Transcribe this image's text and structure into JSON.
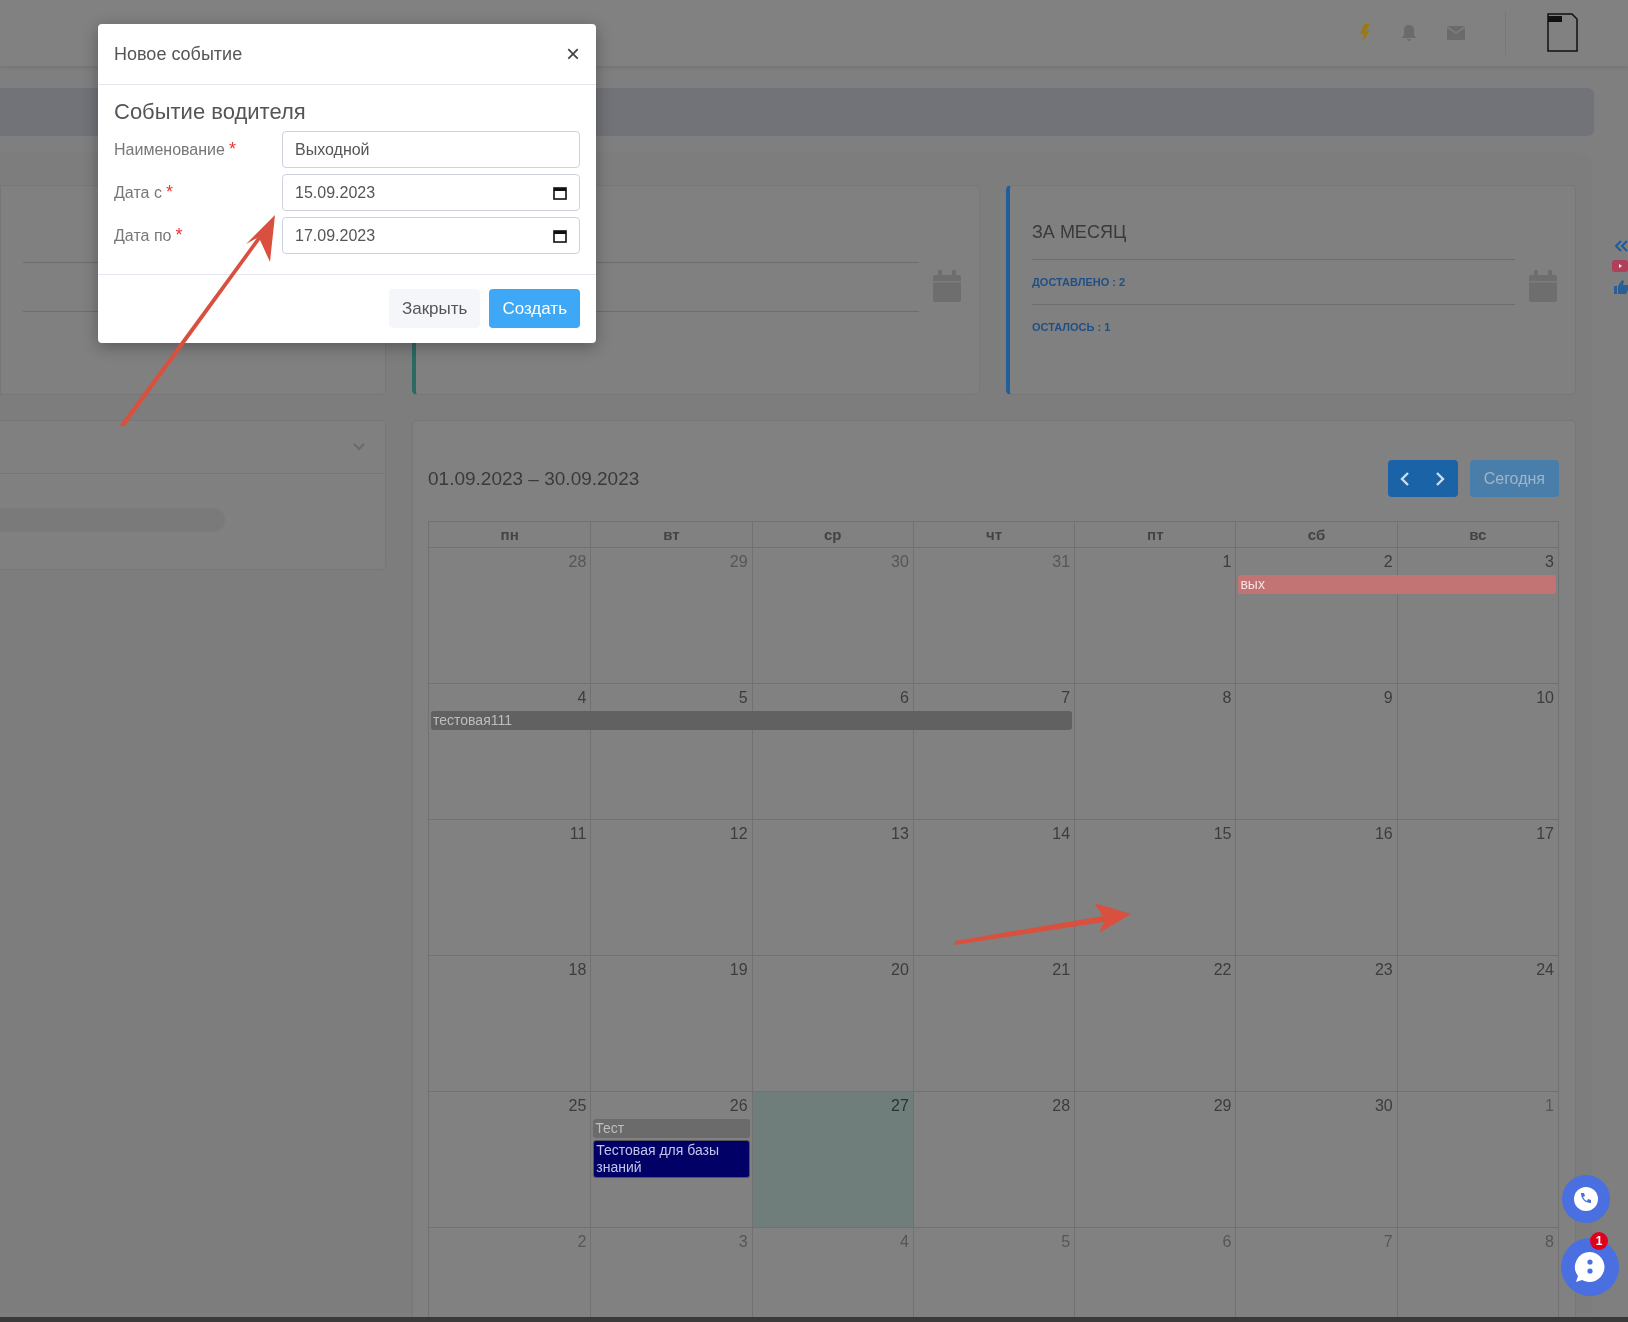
{
  "modal": {
    "title": "Новое событие",
    "close": "×",
    "heading": "Событие водителя",
    "fields": [
      {
        "kind": "text",
        "label": "Наименование",
        "required_mark": "*",
        "value": "Выходной"
      },
      {
        "kind": "date",
        "label": "Дата с",
        "required_mark": "*",
        "value": "15.09.2023"
      },
      {
        "kind": "date",
        "label": "Дата по",
        "required_mark": "*",
        "value": "17.09.2023"
      }
    ],
    "buttons": [
      {
        "kind": "secondary",
        "label": "Закрыть"
      },
      {
        "kind": "primary",
        "label": "Создать"
      }
    ]
  },
  "month_card": {
    "title": "ЗА МЕСЯЦ",
    "stats": [
      "ДОСТАВЛЕНО : 2",
      "ОСТАЛОСЬ : 1"
    ]
  },
  "calendar": {
    "range": "01.09.2023 – 30.09.2023",
    "today_button": "Сегодня",
    "weekdays": [
      "пн",
      "вт",
      "ср",
      "чт",
      "пт",
      "сб",
      "вс"
    ],
    "weeks": [
      {
        "days": [
          {
            "day": "28",
            "other_month": true,
            "today": false
          },
          {
            "day": "29",
            "other_month": true,
            "today": false
          },
          {
            "day": "30",
            "other_month": true,
            "today": false
          },
          {
            "day": "31",
            "other_month": true,
            "today": false
          },
          {
            "day": "1",
            "other_month": false,
            "today": false
          },
          {
            "day": "2",
            "other_month": false,
            "today": false,
            "events": [
              {
                "kind": "start",
                "title": "вых",
                "color": "#c27373"
              }
            ]
          },
          {
            "day": "3",
            "other_month": false,
            "today": false,
            "events": [
              {
                "kind": "continued",
                "color": "#c27373"
              }
            ]
          }
        ]
      },
      {
        "days": [
          {
            "day": "4",
            "other_month": false,
            "today": false,
            "events": [
              {
                "kind": "start",
                "title": "тестовая111",
                "color": "#616161"
              }
            ]
          },
          {
            "day": "5",
            "other_month": false,
            "today": false,
            "events": [
              {
                "kind": "continued",
                "color": "#616161"
              }
            ]
          },
          {
            "day": "6",
            "other_month": false,
            "today": false,
            "events": [
              {
                "kind": "continued",
                "color": "#616161"
              }
            ]
          },
          {
            "day": "7",
            "other_month": false,
            "today": false,
            "events": [
              {
                "kind": "continued",
                "color": "#616161"
              }
            ]
          },
          {
            "day": "8",
            "other_month": false,
            "today": false
          },
          {
            "day": "9",
            "other_month": false,
            "today": false
          },
          {
            "day": "10",
            "other_month": false,
            "today": false
          }
        ]
      },
      {
        "days": [
          {
            "day": "11",
            "other_month": false,
            "today": false
          },
          {
            "day": "12",
            "other_month": false,
            "today": false
          },
          {
            "day": "13",
            "other_month": false,
            "today": false
          },
          {
            "day": "14",
            "other_month": false,
            "today": false
          },
          {
            "day": "15",
            "other_month": false,
            "today": false
          },
          {
            "day": "16",
            "other_month": false,
            "today": false
          },
          {
            "day": "17",
            "other_month": false,
            "today": false
          }
        ]
      },
      {
        "days": [
          {
            "day": "18",
            "other_month": false,
            "today": false
          },
          {
            "day": "19",
            "other_month": false,
            "today": false
          },
          {
            "day": "20",
            "other_month": false,
            "today": false
          },
          {
            "day": "21",
            "other_month": false,
            "today": false
          },
          {
            "day": "22",
            "other_month": false,
            "today": false
          },
          {
            "day": "23",
            "other_month": false,
            "today": false
          },
          {
            "day": "24",
            "other_month": false,
            "today": false
          }
        ]
      },
      {
        "days": [
          {
            "day": "25",
            "other_month": false,
            "today": false
          },
          {
            "day": "26",
            "other_month": false,
            "today": false,
            "events": [
              {
                "kind": "start",
                "title": "Тест",
                "color": "#6b6b6b"
              },
              {
                "kind": "start",
                "title": "Тестовая для базы знаний",
                "color": "#000066"
              }
            ]
          },
          {
            "day": "27",
            "other_month": false,
            "today": true
          },
          {
            "day": "28",
            "other_month": false,
            "today": false
          },
          {
            "day": "29",
            "other_month": false,
            "today": false
          },
          {
            "day": "30",
            "other_month": false,
            "today": false
          },
          {
            "day": "1",
            "other_month": true,
            "today": false
          }
        ]
      },
      {
        "days": [
          {
            "day": "2",
            "other_month": true,
            "today": false
          },
          {
            "day": "3",
            "other_month": true,
            "today": false
          },
          {
            "day": "4",
            "other_month": true,
            "today": false
          },
          {
            "day": "5",
            "other_month": true,
            "today": false
          },
          {
            "day": "6",
            "other_month": true,
            "today": false
          },
          {
            "day": "7",
            "other_month": true,
            "today": false
          },
          {
            "day": "8",
            "other_month": true,
            "today": false
          }
        ]
      }
    ]
  },
  "chat_badge": "1"
}
